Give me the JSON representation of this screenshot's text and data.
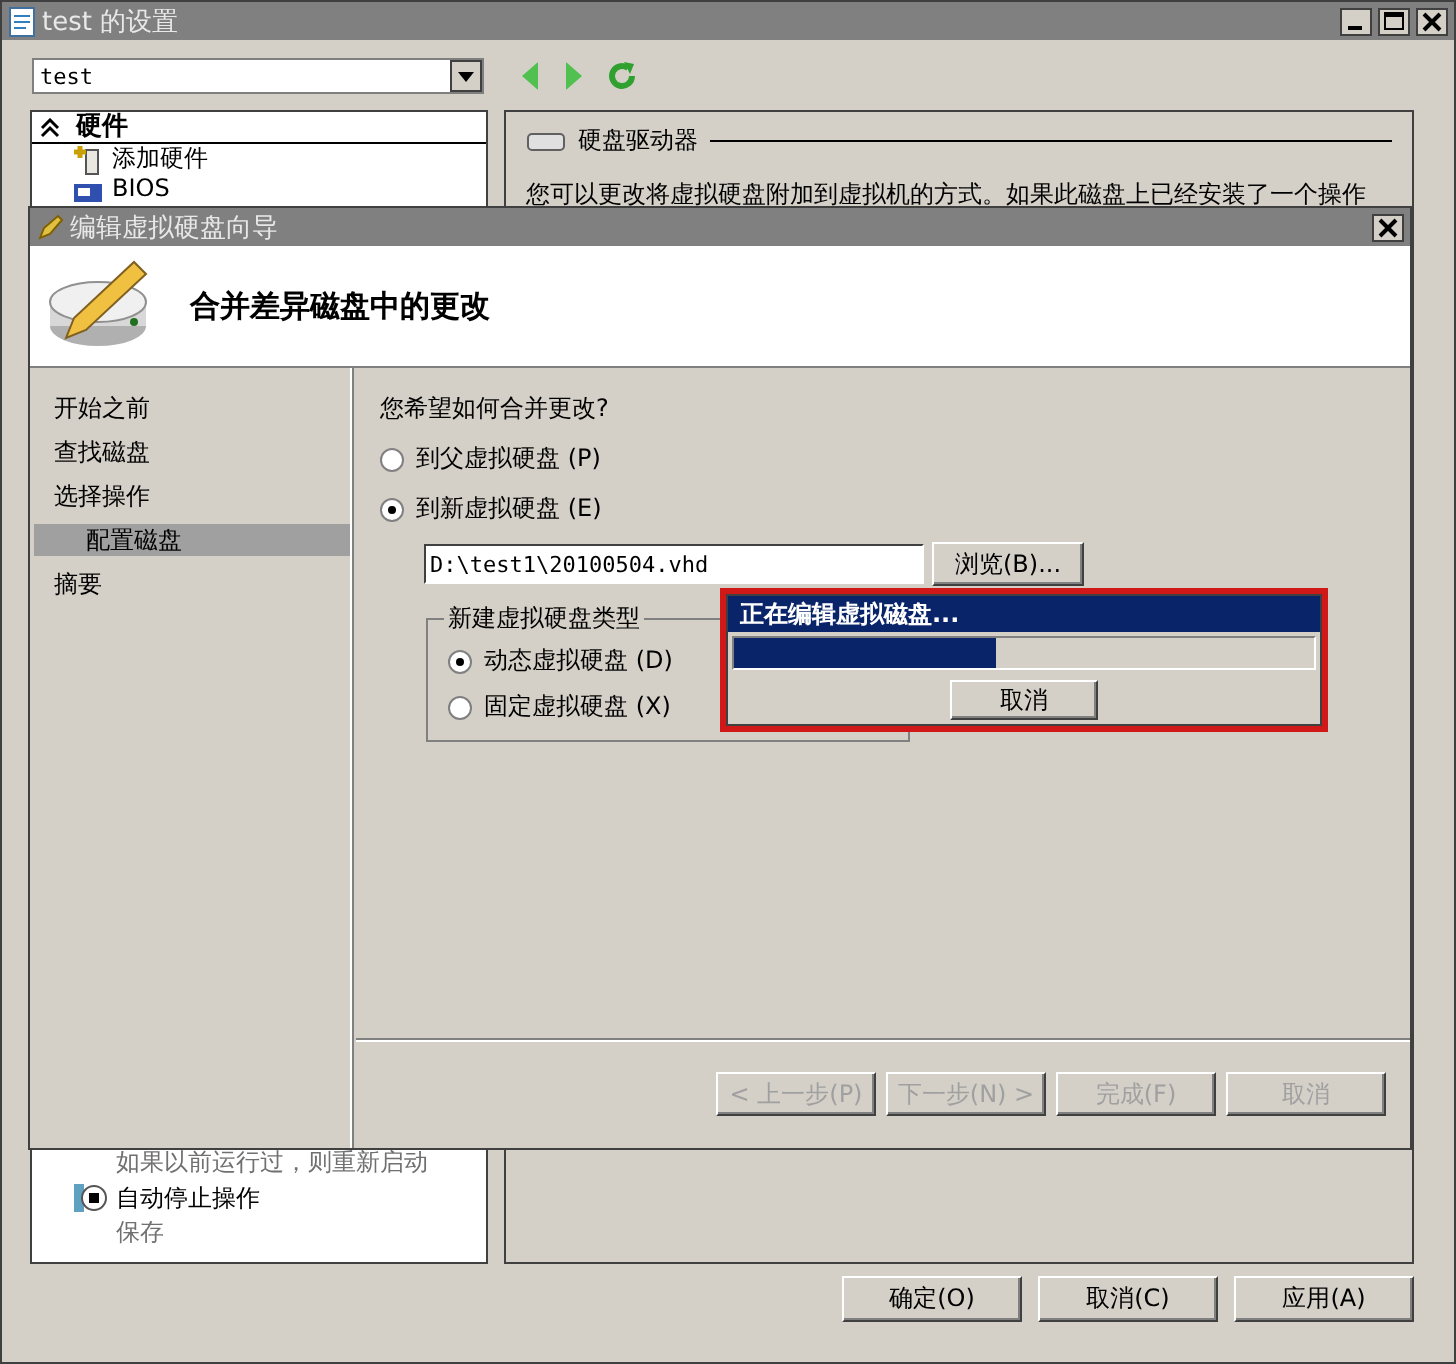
{
  "window": {
    "title": "test 的设置",
    "vm_selector": "test"
  },
  "sidebar": {
    "header": "硬件",
    "expanded": true,
    "items": [
      {
        "label": "添加硬件",
        "kind": "add"
      },
      {
        "label": "BIOS",
        "kind": "bios"
      }
    ],
    "bottom_items": [
      {
        "sub": "如果以前运行过，则重新启动"
      },
      {
        "label": "自动停止操作",
        "sub": "保存"
      }
    ]
  },
  "details": {
    "section": "硬盘驱动器",
    "text": "您可以更改将虚拟硬盘附加到虚拟机的方式。如果此磁盘上已经安装了一个操作"
  },
  "buttons": [
    "确定(O)",
    "取消(C)",
    "应用(A)"
  ],
  "wizard": {
    "title": "编辑虚拟硬盘向导",
    "heading": "合并差异磁盘中的更改",
    "steps": [
      {
        "label": "开始之前",
        "selected": false
      },
      {
        "label": "查找磁盘",
        "selected": false
      },
      {
        "label": "选择操作",
        "selected": false,
        "children": [
          {
            "label": "配置磁盘",
            "selected": true
          }
        ]
      },
      {
        "label": "摘要",
        "selected": false
      }
    ],
    "question": "您希望如何合并更改?",
    "options": [
      {
        "label": "到父虚拟硬盘 (P)",
        "selected": false
      },
      {
        "label": "到新虚拟硬盘 (E)",
        "selected": true
      }
    ],
    "path": "D:\\test1\\20100504.vhd",
    "browse": "浏览(B)...",
    "disk_type": {
      "legend": "新建虚拟硬盘类型",
      "options": [
        {
          "label": "动态虚拟硬盘 (D)",
          "selected": true
        },
        {
          "label": "固定虚拟硬盘 (X)",
          "selected": false
        }
      ]
    },
    "buttons": [
      {
        "label": "< 上一步(P)",
        "disabled": true
      },
      {
        "label": "下一步(N) >",
        "disabled": true
      },
      {
        "label": "完成(F)",
        "disabled": true
      },
      {
        "label": "取消",
        "disabled": true
      }
    ]
  },
  "progress": {
    "title": "正在编辑虚拟磁盘...",
    "level": 0.45,
    "button": "取消"
  }
}
